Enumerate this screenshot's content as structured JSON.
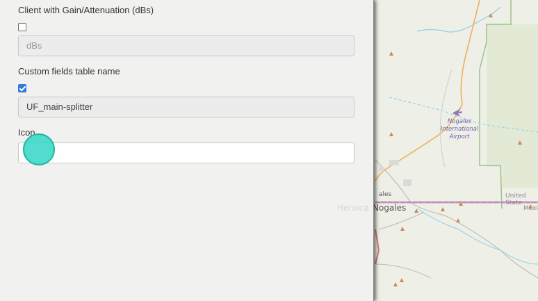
{
  "form": {
    "gain_label": "Client with Gain/Attenuation (dBs)",
    "gain_checked": false,
    "gain_placeholder": "dBs",
    "custom_label": "Custom fields table name",
    "custom_checked": true,
    "custom_value": "UF_main-splitter",
    "icon_label": "Icon",
    "icon_value": ""
  },
  "map": {
    "airport_line1": "Nogales",
    "airport_line2": "International",
    "airport_line3": "Airport",
    "city_small": "ales",
    "city_main": "Nogales",
    "city_faded": "Heroica",
    "country_us": "United State",
    "country_mx": "México"
  },
  "colors": {
    "accent": "#2f7be0",
    "cursor": "#34d6c4",
    "border_green": "#9cc28a",
    "road_orange": "#f2b46a",
    "water_blue": "#9dd3e8",
    "peak_brown": "#c98a5a"
  }
}
